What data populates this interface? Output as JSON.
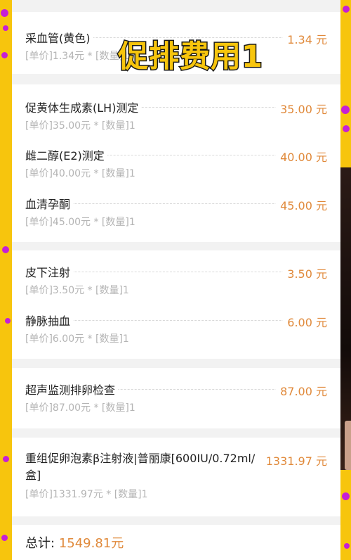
{
  "overlay_title": "促排费用1",
  "sections": [
    {
      "items": [
        {
          "name": "采血管(黄色)",
          "price": "1.34 元",
          "detail": "[单价]1.34元 * [数量]1"
        }
      ]
    },
    {
      "items": [
        {
          "name": "促黄体生成素(LH)测定",
          "price": "35.00 元",
          "detail": "[单价]35.00元 * [数量]1"
        },
        {
          "name": "雌二醇(E2)测定",
          "price": "40.00 元",
          "detail": "[单价]40.00元 * [数量]1"
        },
        {
          "name": "血清孕酮",
          "price": "45.00 元",
          "detail": "[单价]45.00元 * [数量]1"
        }
      ]
    },
    {
      "items": [
        {
          "name": "皮下注射",
          "price": "3.50 元",
          "detail": "[单价]3.50元 * [数量]1"
        },
        {
          "name": "静脉抽血",
          "price": "6.00 元",
          "detail": "[单价]6.00元 * [数量]1"
        }
      ]
    },
    {
      "items": [
        {
          "name": "超声监测排卵检查",
          "price": "87.00 元",
          "detail": "[单价]87.00元 * [数量]1"
        }
      ]
    },
    {
      "items": [
        {
          "name": "重组促卵泡素β注射液|普丽康[600IU/0.72ml/盒]",
          "price": "1331.97 元",
          "detail": "[单价]1331.97元 * [数量]1"
        }
      ]
    }
  ],
  "total": {
    "label": "总计:",
    "amount": "1549.81元"
  },
  "colors": {
    "background": "#f7c50d",
    "price": "#e0893a",
    "dots": "#c61fd6"
  }
}
